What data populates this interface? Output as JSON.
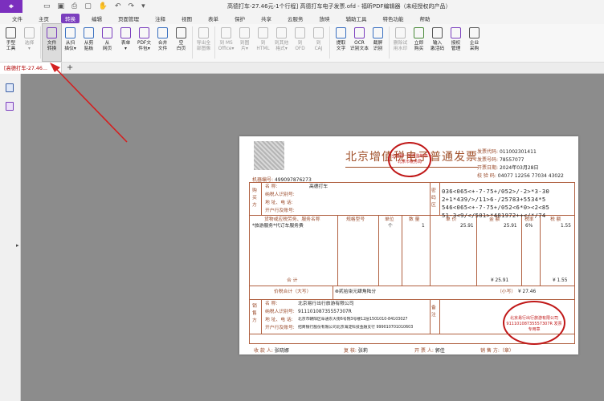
{
  "titlebar": {
    "logo": "",
    "title": "高德打车-27.46元-1个行程] 高德打车电子发票.ofd - 福昕PDF编辑器（未经授权的产品）"
  },
  "menu": {
    "tabs": [
      "文件",
      "主页",
      "转换",
      "编辑",
      "页面管理",
      "注释",
      "视图",
      "表单",
      "保护",
      "共享",
      "云服务",
      "放映",
      "辅助工具",
      "特色功能",
      "帮助"
    ],
    "active": "转换"
  },
  "ribbon": {
    "buttons": [
      {
        "l1": "手型",
        "l2": "工具"
      },
      {
        "l1": "选择",
        "l2": "▾"
      },
      {
        "l1": "文件",
        "l2": "转换"
      },
      {
        "l1": "从扫",
        "l2": "描仪▾"
      },
      {
        "l1": "从剪",
        "l2": "贴板"
      },
      {
        "l1": "从",
        "l2": "网页"
      },
      {
        "l1": "表单",
        "l2": "▾"
      },
      {
        "l1": "PDF文",
        "l2": "件包▾"
      },
      {
        "l1": "合并",
        "l2": "文件"
      },
      {
        "l1": "空",
        "l2": "白页"
      },
      {
        "l1": "导出全",
        "l2": "部图像"
      },
      {
        "l1": "到 MS",
        "l2": "Office▾"
      },
      {
        "l1": "到图",
        "l2": "片▾"
      },
      {
        "l1": "到",
        "l2": "HTML"
      },
      {
        "l1": "到其他",
        "l2": "格式▾"
      },
      {
        "l1": "到",
        "l2": "OFD"
      },
      {
        "l1": "到",
        "l2": "CAJ"
      },
      {
        "l1": "提取",
        "l2": "文字"
      },
      {
        "l1": "OCR",
        "l2": "识别文本"
      },
      {
        "l1": "截屏",
        "l2": "识别"
      },
      {
        "l1": "删除试",
        "l2": "用水印"
      },
      {
        "l1": "立即",
        "l2": "购买"
      },
      {
        "l1": "输入",
        "l2": "激活码"
      },
      {
        "l1": "授权",
        "l2": "管理"
      },
      {
        "l1": "企业",
        "l2": "采购"
      }
    ]
  },
  "doctab": {
    "label": "[高德打车-27.46...",
    "close": "×",
    "new": "+"
  },
  "invoice": {
    "title": "北京增值税电子普通发票",
    "stamp_top": "全国统一发票监制章 北京市税务局",
    "meta": {
      "code_label": "发票代码:",
      "code": "011002301411",
      "num_label": "发票号码:",
      "num": "78557077",
      "date_label": "开票日期:",
      "date": "2024年03月28日",
      "check_label": "校 验 码:",
      "check": "04077 12256 77034 43022"
    },
    "machine_label": "机器编号:",
    "machine": "499097876273",
    "buyer": {
      "side": "购买方",
      "name_label": "名    称:",
      "name": "高德打车",
      "tax_label": "纳税人识别号:",
      "addr_label": "地 址、电 话:",
      "bank_label": "开户行及账号:"
    },
    "pwd_side": "密码区",
    "cipher": "036<065<+-7-75+/052>/-2>*3-30\n2+1*439/>/11>6-/25783+5534*5\n546<065<+-7-75+/052<6*0><2<85\n51-3<9/</501>*481972++</*/74",
    "headers": [
      "货物或应税劳务、服务名称",
      "规格型号",
      "单位",
      "数 量",
      "单 价",
      "金 额",
      "税率",
      "税 额"
    ],
    "row": {
      "name": "*旅游服务*代订车服务费",
      "unit": "个",
      "qty": "1",
      "price": "25.91",
      "amount": "25.91",
      "rate": "6%",
      "tax": "1.55"
    },
    "total_label": "合    计",
    "total_amount": "¥ 25.91",
    "total_tax": "¥ 1.55",
    "sum_label": "价税合计（大写）",
    "sum_words": "⊗贰拾柒元肆角陆分",
    "sum_small_label": "（小写）",
    "sum_small": "¥ 27.46",
    "seller": {
      "side": "销售方",
      "name_label": "名    称:",
      "name": "北京易行出行旅游有限公司",
      "tax_label": "纳税人识别号:",
      "tax": "91110108735557307R",
      "addr_label": "地 址、电 话:",
      "addr": "北京市朝阳区阜通东大街6号院3号楼12层1501010-84103027",
      "bank_label": "开户行及账号:",
      "bank": "招商银行股份有限公司北京海淀科技金融支行 999010701010603"
    },
    "remark_side": "备注",
    "stamp_bot": "北京易行出行旅游有限公司 91110108735557307R 发票专用章",
    "payee_label": "收 款 人:",
    "payee": "张晓娜",
    "review_label": "复 核:",
    "review": "张莉",
    "issuer_label": "开 票 人:",
    "issuer": "郭佳",
    "seller_sig_label": "销 售 方:（章）"
  }
}
